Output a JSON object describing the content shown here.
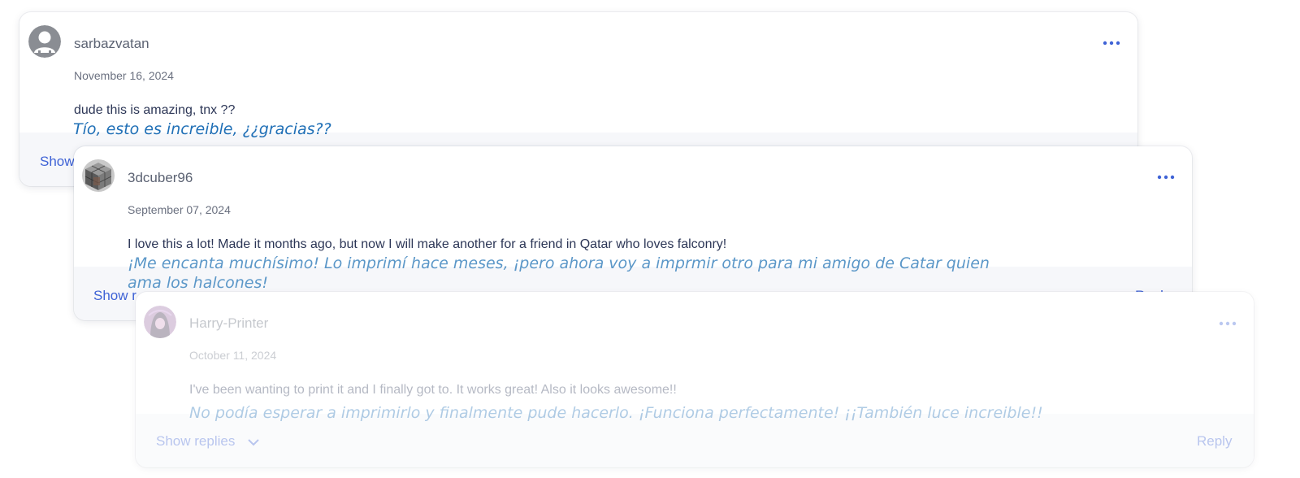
{
  "comments": [
    {
      "username": "sarbazvatan",
      "avatar_icon": "default-user-icon",
      "date": "November 16, 2024",
      "text": "dude this is amazing, tnx ??",
      "translation": "Tío, esto es increible, ¿¿gracias??",
      "show_replies_label": "Show",
      "reply_label": ""
    },
    {
      "username": "3dcuber96",
      "avatar_icon": "rubiks-cube-avatar",
      "date": "September 07, 2024",
      "text": "I love this a lot! Made it months ago, but now I will make another for a friend in Qatar who loves falconry!",
      "translation": "¡Me encanta muchísimo! Lo imprimí hace meses, ¡pero ahora voy a imprmir otro para mi amigo de Catar quien ama los halcones!",
      "show_replies_label": "Show r",
      "reply_label": "Reply"
    },
    {
      "username": "Harry-Printer",
      "avatar_icon": "hooded-figure-avatar",
      "date": "October 11, 2024",
      "text": "I've been wanting to print it and I finally got to. It works great! Also it looks awesome!!",
      "translation": "No podía esperar a imprimirlo y finalmente pude hacerlo. ¡Funciona perfectamente! ¡¡También luce increible!!",
      "show_replies_label": "Show replies",
      "reply_label": "Reply"
    }
  ],
  "icons": {
    "menu": "more-dots-icon",
    "chevron": "chevron-down-icon"
  },
  "colors": {
    "accent": "#3f63d6",
    "translation": "#1f6fb6",
    "text": "#2c3656",
    "muted": "#6b7180"
  }
}
